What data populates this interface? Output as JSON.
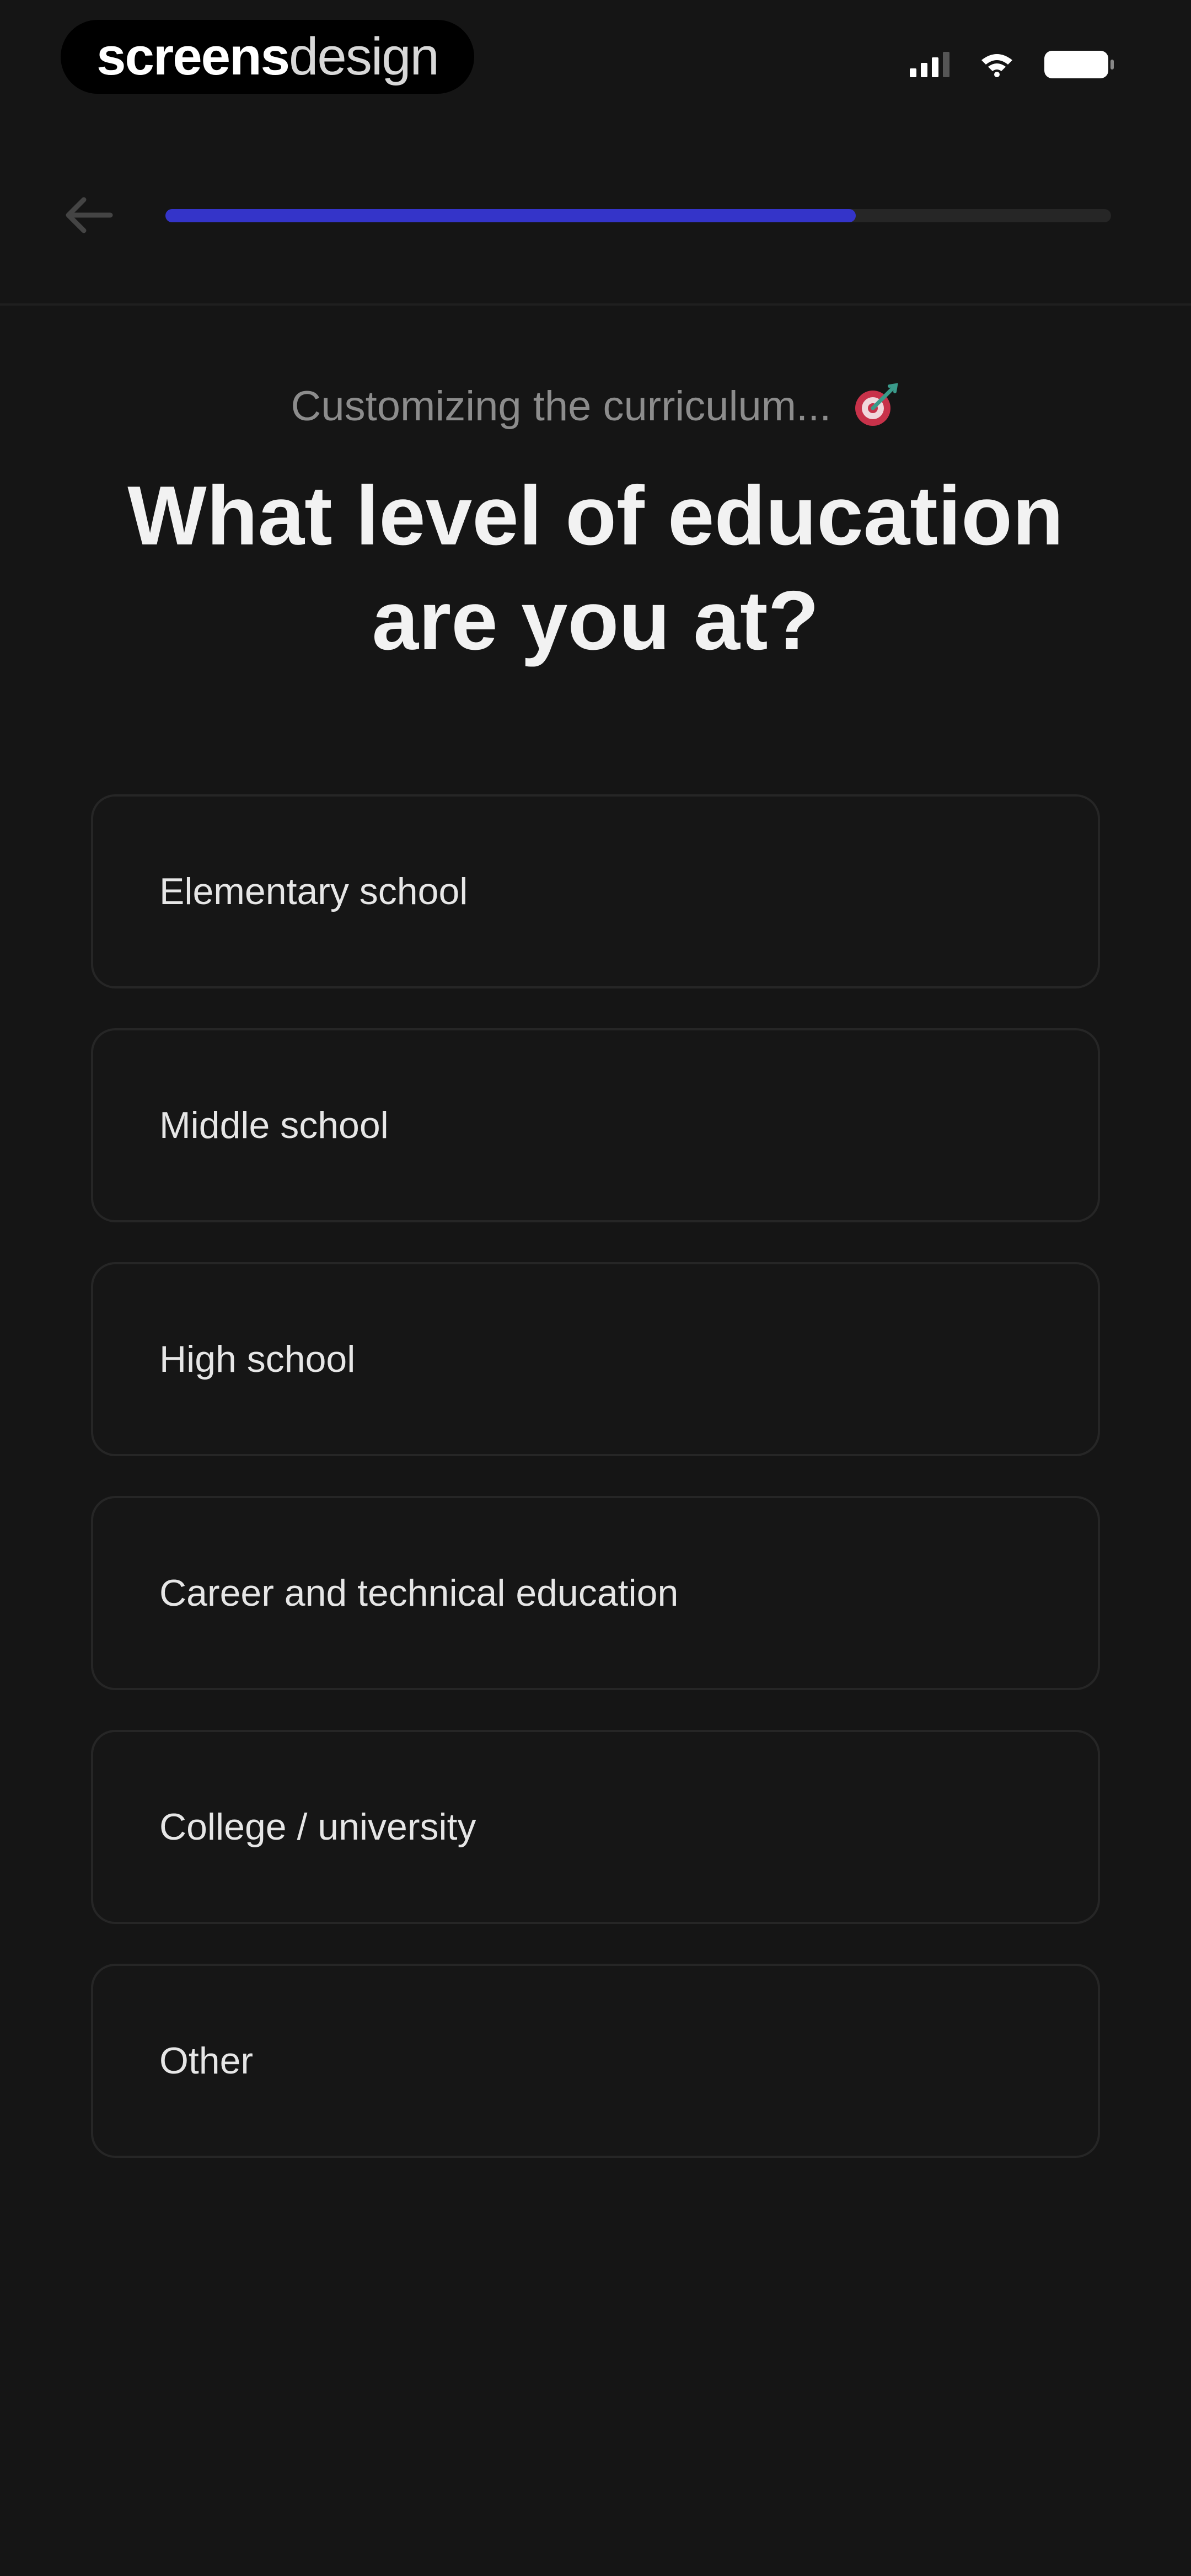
{
  "status_bar": {
    "brand_part1": "screens",
    "brand_part2": "design",
    "icons": [
      "signal-icon",
      "wifi-icon",
      "battery-icon"
    ]
  },
  "header": {
    "back_icon": "arrow-left-icon",
    "progress": 0.73,
    "progress_color": "#3434c9"
  },
  "main": {
    "subtitle": "Customizing the curriculum...",
    "subtitle_emoji": "target-icon",
    "title": "What level of education are you at?",
    "options": [
      "Elementary school",
      "Middle school",
      "High school",
      "Career and technical education",
      "College / university",
      "Other"
    ]
  }
}
